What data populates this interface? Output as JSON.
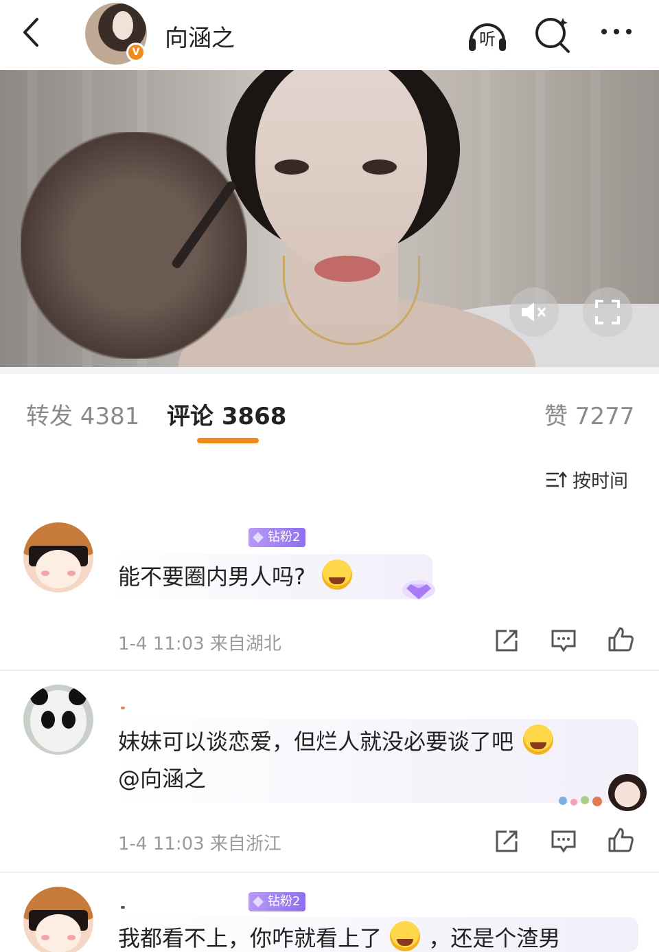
{
  "header": {
    "user_name": "向涵之",
    "verified_badge": "V",
    "icons": [
      "back-arrow-icon",
      "listen-icon",
      "search-icon",
      "more-icon"
    ],
    "listen_label": "听"
  },
  "video": {
    "controls": [
      "mute-icon",
      "fullscreen-icon"
    ]
  },
  "stats": {
    "forward_label": "转发 4381",
    "comment_label": "评论 3868",
    "like_label": "赞 7277",
    "accent_color": "#f08a1c"
  },
  "sort": {
    "label": "按时间"
  },
  "comments": [
    {
      "badge": "钻粉2",
      "text": "能不要圈内男人吗?",
      "time_location": "1-4 11:03 来自湖北",
      "avatar": "maruko-avatar"
    },
    {
      "badge": "",
      "text_line1": "妹妹可以谈恋爱，但烂人就没必要谈了吧",
      "text_line2": "@向涵之",
      "time_location": "1-4 11:03 来自浙江",
      "avatar": "panda-avatar"
    },
    {
      "badge": "钻粉2",
      "text": "我都看不上，你咋就看上了",
      "text_tail": "，还是个渣男",
      "avatar": "maruko-avatar"
    }
  ],
  "actions": [
    "share-icon",
    "comment-icon",
    "like-icon"
  ],
  "badge_color": "#9b7cf2"
}
